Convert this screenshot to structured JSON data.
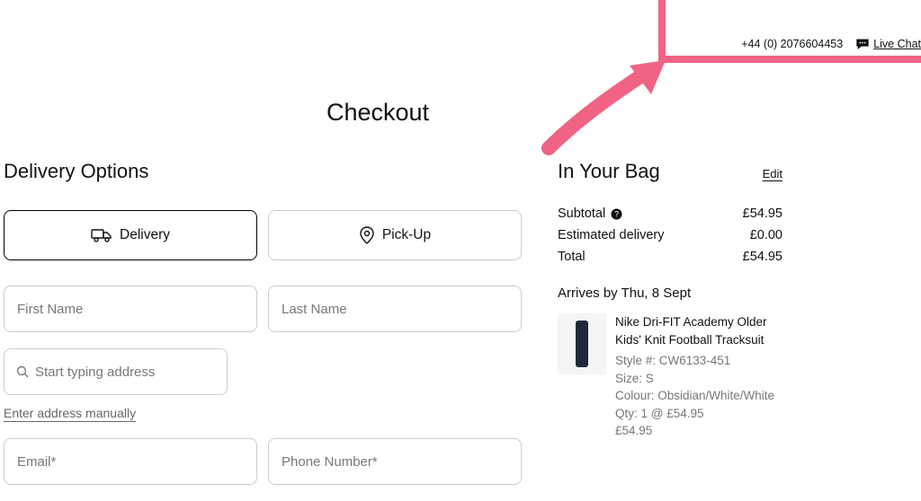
{
  "header": {
    "phone": "+44 (0) 2076604453",
    "live_chat": "Live Chat"
  },
  "page_title": "Checkout",
  "delivery": {
    "heading": "Delivery Options",
    "delivery_label": "Delivery",
    "pickup_label": "Pick-Up",
    "first_name_ph": "First Name",
    "last_name_ph": "Last Name",
    "address_ph": "Start typing address",
    "manual_link": "Enter address manually",
    "email_ph": "Email*",
    "phone_ph": "Phone Number*"
  },
  "bag": {
    "title": "In Your Bag",
    "edit": "Edit",
    "subtotal_label": "Subtotal",
    "subtotal_value": "£54.95",
    "shipping_label": "Estimated delivery",
    "shipping_value": "£0.00",
    "total_label": "Total",
    "total_value": "£54.95",
    "arrives": "Arrives by Thu, 8 Sept",
    "item": {
      "name": "Nike Dri-FIT Academy Older Kids' Knit Football Tracksuit",
      "style": "Style #: CW6133-451",
      "size": "Size: S",
      "colour": "Colour: Obsidian/White/White",
      "qty": "Qty: 1 @ £54.95",
      "price": "£54.95"
    }
  }
}
